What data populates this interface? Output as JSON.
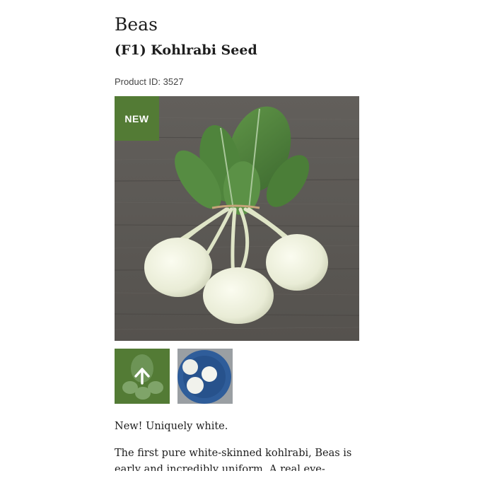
{
  "product": {
    "name": "Beas",
    "subtitle": "(F1) Kohlrabi Seed",
    "product_id": "Product ID: 3527",
    "badge": "NEW"
  },
  "gallery": {
    "thumbnails": [
      {
        "label": "kohlrabi-bunch-thumb",
        "icon": "arrow-up-icon"
      },
      {
        "label": "kohlrabi-plate-thumb"
      }
    ]
  },
  "description": {
    "lead": "New! Uniquely white.",
    "body": "The first pure white-skinned kohlrabi, Beas is early and incredibly uniform. A real eye-catching beauty"
  },
  "colors": {
    "accent": "#537b35",
    "wood": "#5e5c58",
    "leaf": "#4d7f3a",
    "bulb": "#eef0df"
  }
}
